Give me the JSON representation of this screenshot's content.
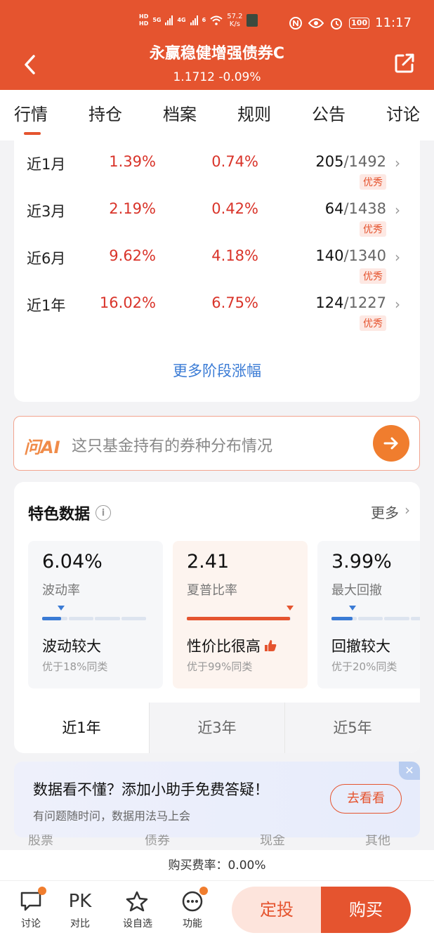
{
  "status_bar": {
    "hd1": "HD",
    "hd2": "HD",
    "net1": "5G",
    "net2": "4G",
    "wifi_num": "6",
    "speed": "57.2",
    "speed_unit": "K/s",
    "battery": "100",
    "time": "11:17"
  },
  "header": {
    "title": "永赢稳健增强债券C",
    "subtitle": "1.1712 -0.09%",
    "back_icon": "chevron-left-icon",
    "share_icon": "share-icon"
  },
  "tabs": [
    {
      "label": "行情",
      "active": true
    },
    {
      "label": "持仓"
    },
    {
      "label": "档案"
    },
    {
      "label": "规则"
    },
    {
      "label": "公告"
    },
    {
      "label": "讨论"
    }
  ],
  "performance": {
    "rows": [
      {
        "period": "近1月",
        "return": "1.39%",
        "benchmark": "0.74%",
        "rank": "205",
        "total": "/1492",
        "badge": "优秀"
      },
      {
        "period": "近3月",
        "return": "2.19%",
        "benchmark": "0.42%",
        "rank": "64",
        "total": "/1438",
        "badge": "优秀"
      },
      {
        "period": "近6月",
        "return": "9.62%",
        "benchmark": "4.18%",
        "rank": "140",
        "total": "/1340",
        "badge": "优秀"
      },
      {
        "period": "近1年",
        "return": "16.02%",
        "benchmark": "6.75%",
        "rank": "124",
        "total": "/1227",
        "badge": "优秀"
      }
    ],
    "more_label": "更多阶段涨幅"
  },
  "ask_ai": {
    "logo": "问AI",
    "prompt": "这只基金持有的券种分布情况"
  },
  "featured": {
    "title": "特色数据",
    "more": "更多",
    "metrics": [
      {
        "value": "6.04%",
        "name": "波动率",
        "verdict": "波动较大",
        "note": "优于18%同类",
        "level": 0.18
      },
      {
        "value": "2.41",
        "name": "夏普比率",
        "verdict": "性价比很高",
        "note": "优于99%同类",
        "level": 0.99
      },
      {
        "value": "3.99%",
        "name": "最大回撤",
        "verdict": "回撤较大",
        "note": "优于20%同类",
        "level": 0.2
      }
    ],
    "periods": [
      {
        "label": "近1年",
        "active": true
      },
      {
        "label": "近3年"
      },
      {
        "label": "近5年"
      }
    ]
  },
  "promo": {
    "title": "数据看不懂？添加小助手免费答疑！",
    "subtitle": "有问题随时问，数据用法马上会",
    "button": "去看看",
    "peek": [
      "股票",
      "债券",
      "现金",
      "其他"
    ]
  },
  "fee": "购买费率：0.00%",
  "bottom": {
    "items": [
      {
        "label": "讨论",
        "icon": "chat-icon",
        "dot": true
      },
      {
        "label": "对比",
        "icon": "pk-icon",
        "icon_text": "PK"
      },
      {
        "label": "设自选",
        "icon": "star-add-icon"
      },
      {
        "label": "功能",
        "icon": "more-icon",
        "dot": true
      }
    ],
    "sip": "定投",
    "buy": "购买"
  },
  "colors": {
    "brand": "#e5542f",
    "up": "#d9342a",
    "link": "#3a7bd5"
  }
}
